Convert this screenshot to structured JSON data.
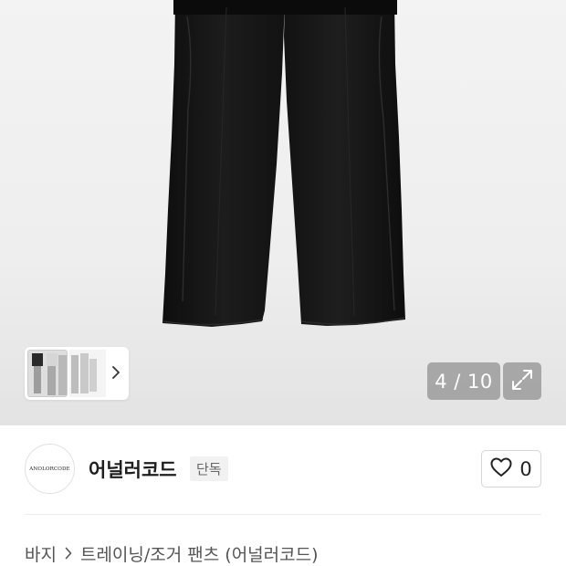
{
  "gallery": {
    "current": 4,
    "total": 10,
    "counter_text": "4 / 10"
  },
  "brand": {
    "logo_text": "ANOLORCODE",
    "name": "어널러코드",
    "badge": "단독"
  },
  "like": {
    "count": "0"
  },
  "breadcrumb": {
    "items": [
      "바지",
      "트레이닝/조거 팬츠 (어널러코드)"
    ]
  },
  "colors": {
    "hero_bg": "#eeeeee",
    "pants": "#151515",
    "overlay": "#808080",
    "badge_bg": "#f1f1f1"
  },
  "icons": {
    "thumb_next": "chevron-right-icon",
    "expand": "expand-arrows-icon",
    "like": "heart-outline-icon",
    "breadcrumb_sep": "chevron-right-icon"
  }
}
